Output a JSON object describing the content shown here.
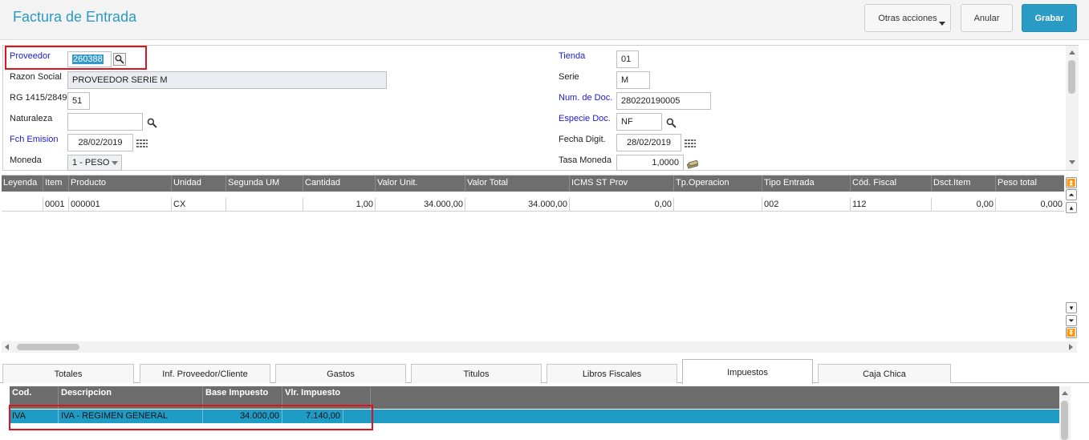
{
  "header": {
    "title": "Factura de Entrada",
    "buttons": {
      "otras": "Otras acciones",
      "anular": "Anular",
      "grabar": "Grabar"
    }
  },
  "form": {
    "proveedor": {
      "label": "Proveedor",
      "value": "260388"
    },
    "razon_social": {
      "label": "Razon Social",
      "value": "PROVEEDOR SERIE M"
    },
    "rg": {
      "label": "RG 1415/2849",
      "value": "51"
    },
    "naturaleza": {
      "label": "Naturaleza",
      "value": ""
    },
    "fch_emision": {
      "label": "Fch Emision",
      "value": "28/02/2019"
    },
    "moneda": {
      "label": "Moneda",
      "value": "1 - PESO"
    },
    "tienda": {
      "label": "Tienda",
      "value": "01"
    },
    "serie": {
      "label": "Serie",
      "value": "M"
    },
    "num_doc": {
      "label": "Num. de Doc.",
      "value": "280220190005"
    },
    "especie_doc": {
      "label": "Especie Doc.",
      "value": "NF"
    },
    "fecha_digit": {
      "label": "Fecha Digit.",
      "value": "28/02/2019"
    },
    "tasa_moneda": {
      "label": "Tasa Moneda",
      "value": "1,0000"
    }
  },
  "grid": {
    "columns": [
      "Leyenda",
      "Item",
      "Producto",
      "Unidad",
      "Segunda UM",
      "Cantidad",
      "Valor Unit.",
      "Valor Total",
      "ICMS ST Prov",
      "Tp.Operacion",
      "Tipo Entrada",
      "Cód. Fiscal",
      "Dsct.Item",
      "Peso total"
    ],
    "rows": [
      [
        "",
        "0001",
        "000001",
        "CX",
        "",
        "1,00",
        "34.000,00",
        "34.000,00",
        "0,00",
        "",
        "002",
        "112",
        "0,00",
        "0,000"
      ]
    ]
  },
  "tabs": [
    "Totales",
    "Inf. Proveedor/Cliente",
    "Gastos",
    "Titulos",
    "Libros Fiscales",
    "Impuestos",
    "Caja Chica"
  ],
  "active_tab": "Impuestos",
  "taxes": {
    "columns": [
      "Cod.",
      "Descripcion",
      "Base Impuesto",
      "Vlr. Impuesto"
    ],
    "rows": [
      [
        "IVA",
        "IVA - REGIMEN GENERAL",
        "34.000,00",
        "7.140,00"
      ]
    ]
  },
  "icons": [
    "search-icon",
    "calendar-icon",
    "dropdown-arrow-icon",
    "exchange-rate-icon"
  ],
  "colors": {
    "accent": "#2a9bc4",
    "selected_row": "#1f9cc6",
    "highlight": "#e0121c",
    "required_label": "#1a1adb"
  }
}
